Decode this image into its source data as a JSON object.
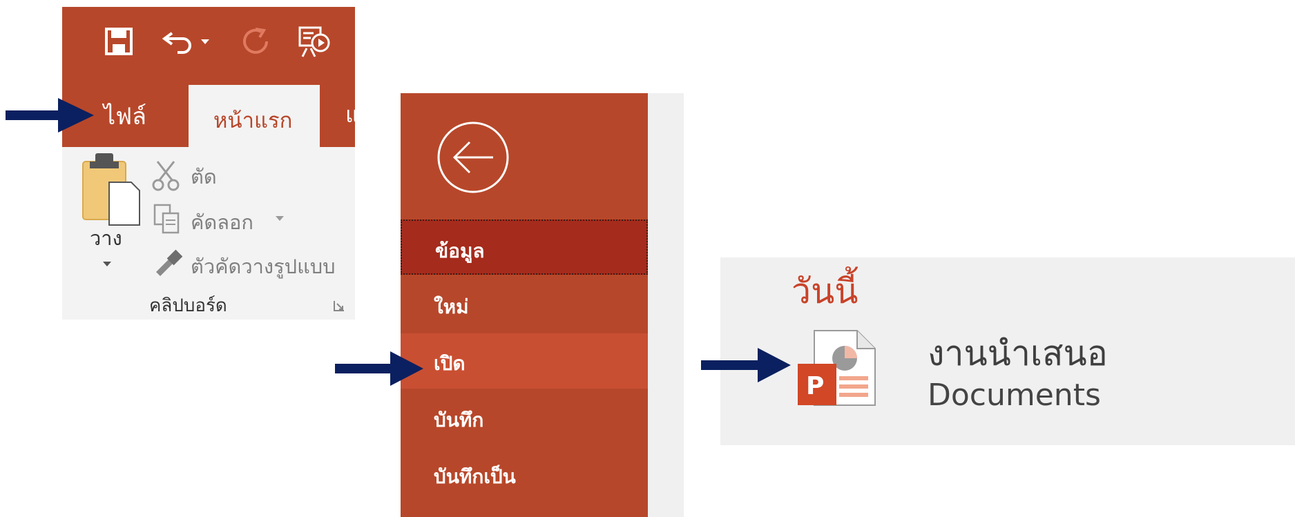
{
  "ribbon": {
    "tabs": {
      "file": "ไฟล์",
      "home": "หน้าแรก",
      "next_partial": "แ"
    },
    "clipboard": {
      "paste": "วาง",
      "cut": "ตัด",
      "copy": "คัดลอก",
      "format_painter": "ตัวคัดวางรูปแบบ",
      "group_label": "คลิปบอร์ด"
    }
  },
  "backstage": {
    "items": [
      {
        "label": "ข้อมูล"
      },
      {
        "label": "ใหม่"
      },
      {
        "label": "เปิด"
      },
      {
        "label": "บันทึก"
      },
      {
        "label": "บันทึกเป็น"
      }
    ]
  },
  "recent": {
    "group_title": "วันนี้",
    "file": {
      "name": "งานนำเสนอ",
      "location": "Documents"
    }
  },
  "colors": {
    "accent": "#b7472a",
    "accent_dark": "#a52b1c",
    "accent_hover": "#c94f32",
    "arrow": "#0b2060"
  }
}
